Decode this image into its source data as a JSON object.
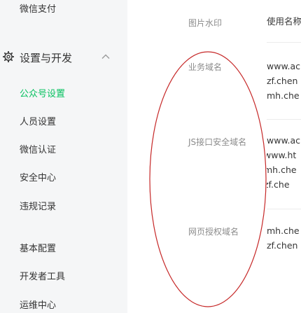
{
  "sidebar": {
    "partial_top_item": "微信支付",
    "section": {
      "title": "设置与开发",
      "icon": "gear-icon",
      "toggle_icon": "chevron-up-icon"
    },
    "items": [
      {
        "label": "公众号设置",
        "active": true
      },
      {
        "label": "人员设置"
      },
      {
        "label": "微信认证"
      },
      {
        "label": "安全中心"
      },
      {
        "label": "违规记录"
      },
      {
        "label": "基本配置"
      },
      {
        "label": "开发者工具"
      },
      {
        "label": "运维中心"
      }
    ],
    "active_color": "#07c160"
  },
  "main": {
    "rows": [
      {
        "label": "图片水印",
        "values": [
          "使用名称"
        ]
      },
      {
        "label": "业务域名",
        "values": [
          "www.ac",
          "zf.chen",
          "mh.che"
        ]
      },
      {
        "label": "JS接口安全域名",
        "values": [
          "www.ac",
          "www.ht",
          "mh.che",
          "zf.che"
        ]
      },
      {
        "label": "网页授权域名",
        "values": [
          "mh.che",
          "zf.chen"
        ]
      }
    ]
  },
  "annotation": {
    "shape": "ellipse",
    "color": "#c62828"
  }
}
